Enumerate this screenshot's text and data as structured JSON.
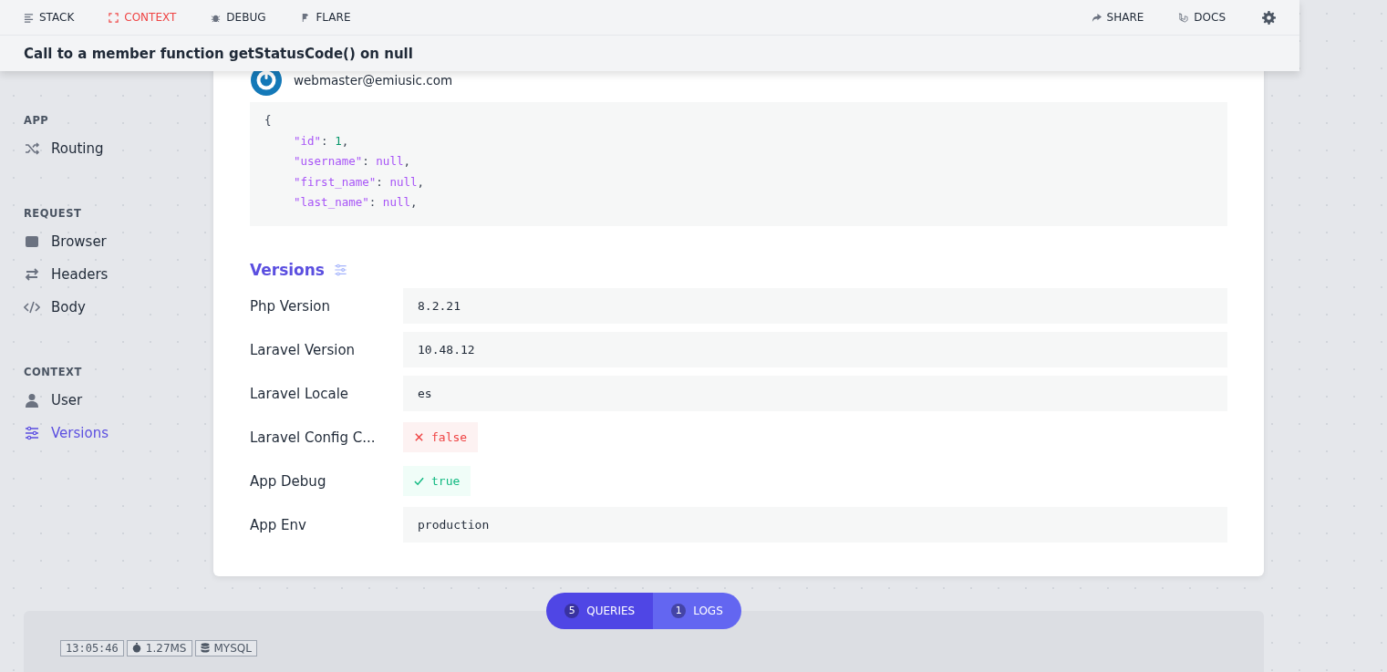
{
  "nav": {
    "tabs": [
      {
        "label": "STACK",
        "selected": false
      },
      {
        "label": "CONTEXT",
        "selected": true
      },
      {
        "label": "DEBUG",
        "selected": false
      },
      {
        "label": "FLARE",
        "selected": false
      }
    ],
    "actions": [
      "SHARE",
      "DOCS"
    ]
  },
  "error_title": "Call to a member function getStatusCode() on null",
  "sidebar": {
    "groups": [
      {
        "title": "APP",
        "items": [
          {
            "label": "Routing",
            "selected": false
          }
        ]
      },
      {
        "title": "REQUEST",
        "items": [
          {
            "label": "Browser",
            "selected": false
          },
          {
            "label": "Headers",
            "selected": false
          },
          {
            "label": "Body",
            "selected": false
          }
        ]
      },
      {
        "title": "CONTEXT",
        "items": [
          {
            "label": "User",
            "selected": false
          },
          {
            "label": "Versions",
            "selected": true
          }
        ]
      }
    ]
  },
  "user": {
    "email": "webmaster@emiusic.com",
    "json_lines": [
      [
        {
          "kind": "punct",
          "text": "{"
        }
      ],
      [
        {
          "kind": "key",
          "text": "\"id\""
        },
        {
          "kind": "punct",
          "text": ": "
        },
        {
          "kind": "number",
          "text": "1"
        },
        {
          "kind": "punct",
          "text": ","
        }
      ],
      [
        {
          "kind": "key",
          "text": "\"username\""
        },
        {
          "kind": "punct",
          "text": ": "
        },
        {
          "kind": "null",
          "text": "null"
        },
        {
          "kind": "punct",
          "text": ","
        }
      ],
      [
        {
          "kind": "key",
          "text": "\"first_name\""
        },
        {
          "kind": "punct",
          "text": ": "
        },
        {
          "kind": "null",
          "text": "null"
        },
        {
          "kind": "punct",
          "text": ","
        }
      ],
      [
        {
          "kind": "key",
          "text": "\"last_name\""
        },
        {
          "kind": "punct",
          "text": ": "
        },
        {
          "kind": "null",
          "text": "null"
        },
        {
          "kind": "punct",
          "text": ","
        }
      ]
    ]
  },
  "versions": {
    "title": "Versions",
    "rows": [
      {
        "label": "Php Version",
        "kind": "text",
        "value": "8.2.21"
      },
      {
        "label": "Laravel Version",
        "kind": "text",
        "value": "10.48.12"
      },
      {
        "label": "Laravel Locale",
        "kind": "text",
        "value": "es"
      },
      {
        "label": "Laravel Config C...",
        "kind": "flag",
        "on": false,
        "value": "false"
      },
      {
        "label": "App Debug",
        "kind": "flag",
        "on": true,
        "value": "true"
      },
      {
        "label": "App Env",
        "kind": "text",
        "value": "production"
      }
    ]
  },
  "bottom_tabs": [
    {
      "count": "5",
      "label": "QUERIES",
      "selected": true
    },
    {
      "count": "1",
      "label": "LOGS",
      "selected": false
    }
  ],
  "query": {
    "time": "13:05:46",
    "duration": "1.27MS",
    "connection": "MYSQL"
  }
}
